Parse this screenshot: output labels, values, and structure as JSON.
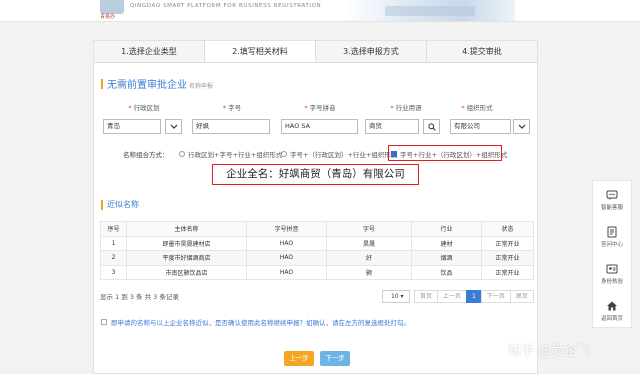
{
  "header": {
    "logo_text": "青易办",
    "platform_en": "QINGDAO SMART PLATFORM FOR BUSINESS REGISTRATION"
  },
  "tabs": [
    "1.选择企业类型",
    "2.填写相关材料",
    "3.选择申报方式",
    "4.提交审批"
  ],
  "active_tab": 1,
  "section": {
    "title": "无需前置审批企业",
    "subtitle": "名称申报"
  },
  "fields": {
    "region_label": "行政区划",
    "zihao_label": "字号",
    "pinyin_label": "字号拼音",
    "industry_label": "行业用语",
    "org_label": "组织形式",
    "region_value": "青岛",
    "zihao_value": "好飒",
    "pinyin_value": "HAO SA",
    "industry_value": "商贸",
    "org_value": "有限公司"
  },
  "combo": {
    "label": "名称组合方式：",
    "options": [
      "行政区划+字号+行业+组织形式",
      "字号+（行政区划）+行业+组织形式",
      "字号+行业+（行政区划）+组织形式"
    ],
    "selected_index": 2
  },
  "full_name": "企业全名：好飒商贸（青岛）有限公司",
  "similar": {
    "title": "近似名称",
    "columns": [
      "序号",
      "主体名称",
      "字号拼音",
      "字号",
      "行业",
      "状态"
    ],
    "rows": [
      [
        "1",
        "即墨市昊晟建材店",
        "HAO",
        "昊晟",
        "建材",
        "正常开业"
      ],
      [
        "2",
        "平度市好烟酒商店",
        "HAO",
        "好",
        "烟酒",
        "正常开业"
      ],
      [
        "3",
        "市南区颢饮品店",
        "HAO",
        "颢",
        "饮品",
        "正常开业"
      ]
    ],
    "summary": "显示 1 到 3 条 共 3 条记录",
    "page_size": "10",
    "pager": [
      "首页",
      "上一页",
      "1",
      "下一页",
      "尾页"
    ]
  },
  "confirm_text": "即申请的名称与以上企业名称近似，是否确认使用此名称继续申报？如确认，请在左方的复选框处打勾。",
  "buttons": {
    "prev": "上一步",
    "next": "下一步"
  },
  "side_bar": [
    {
      "icon": "chat-icon",
      "label": "智能客服"
    },
    {
      "icon": "qa-icon",
      "label": "答问中心"
    },
    {
      "icon": "id-card-icon",
      "label": "身份核验"
    },
    {
      "icon": "home-icon",
      "label": "返回首页"
    }
  ],
  "watermark": "知乎 @爱企飞",
  "colors": {
    "accent": "#3a7bd5",
    "warn": "#f5a623",
    "highlight_box": "#e02020"
  }
}
